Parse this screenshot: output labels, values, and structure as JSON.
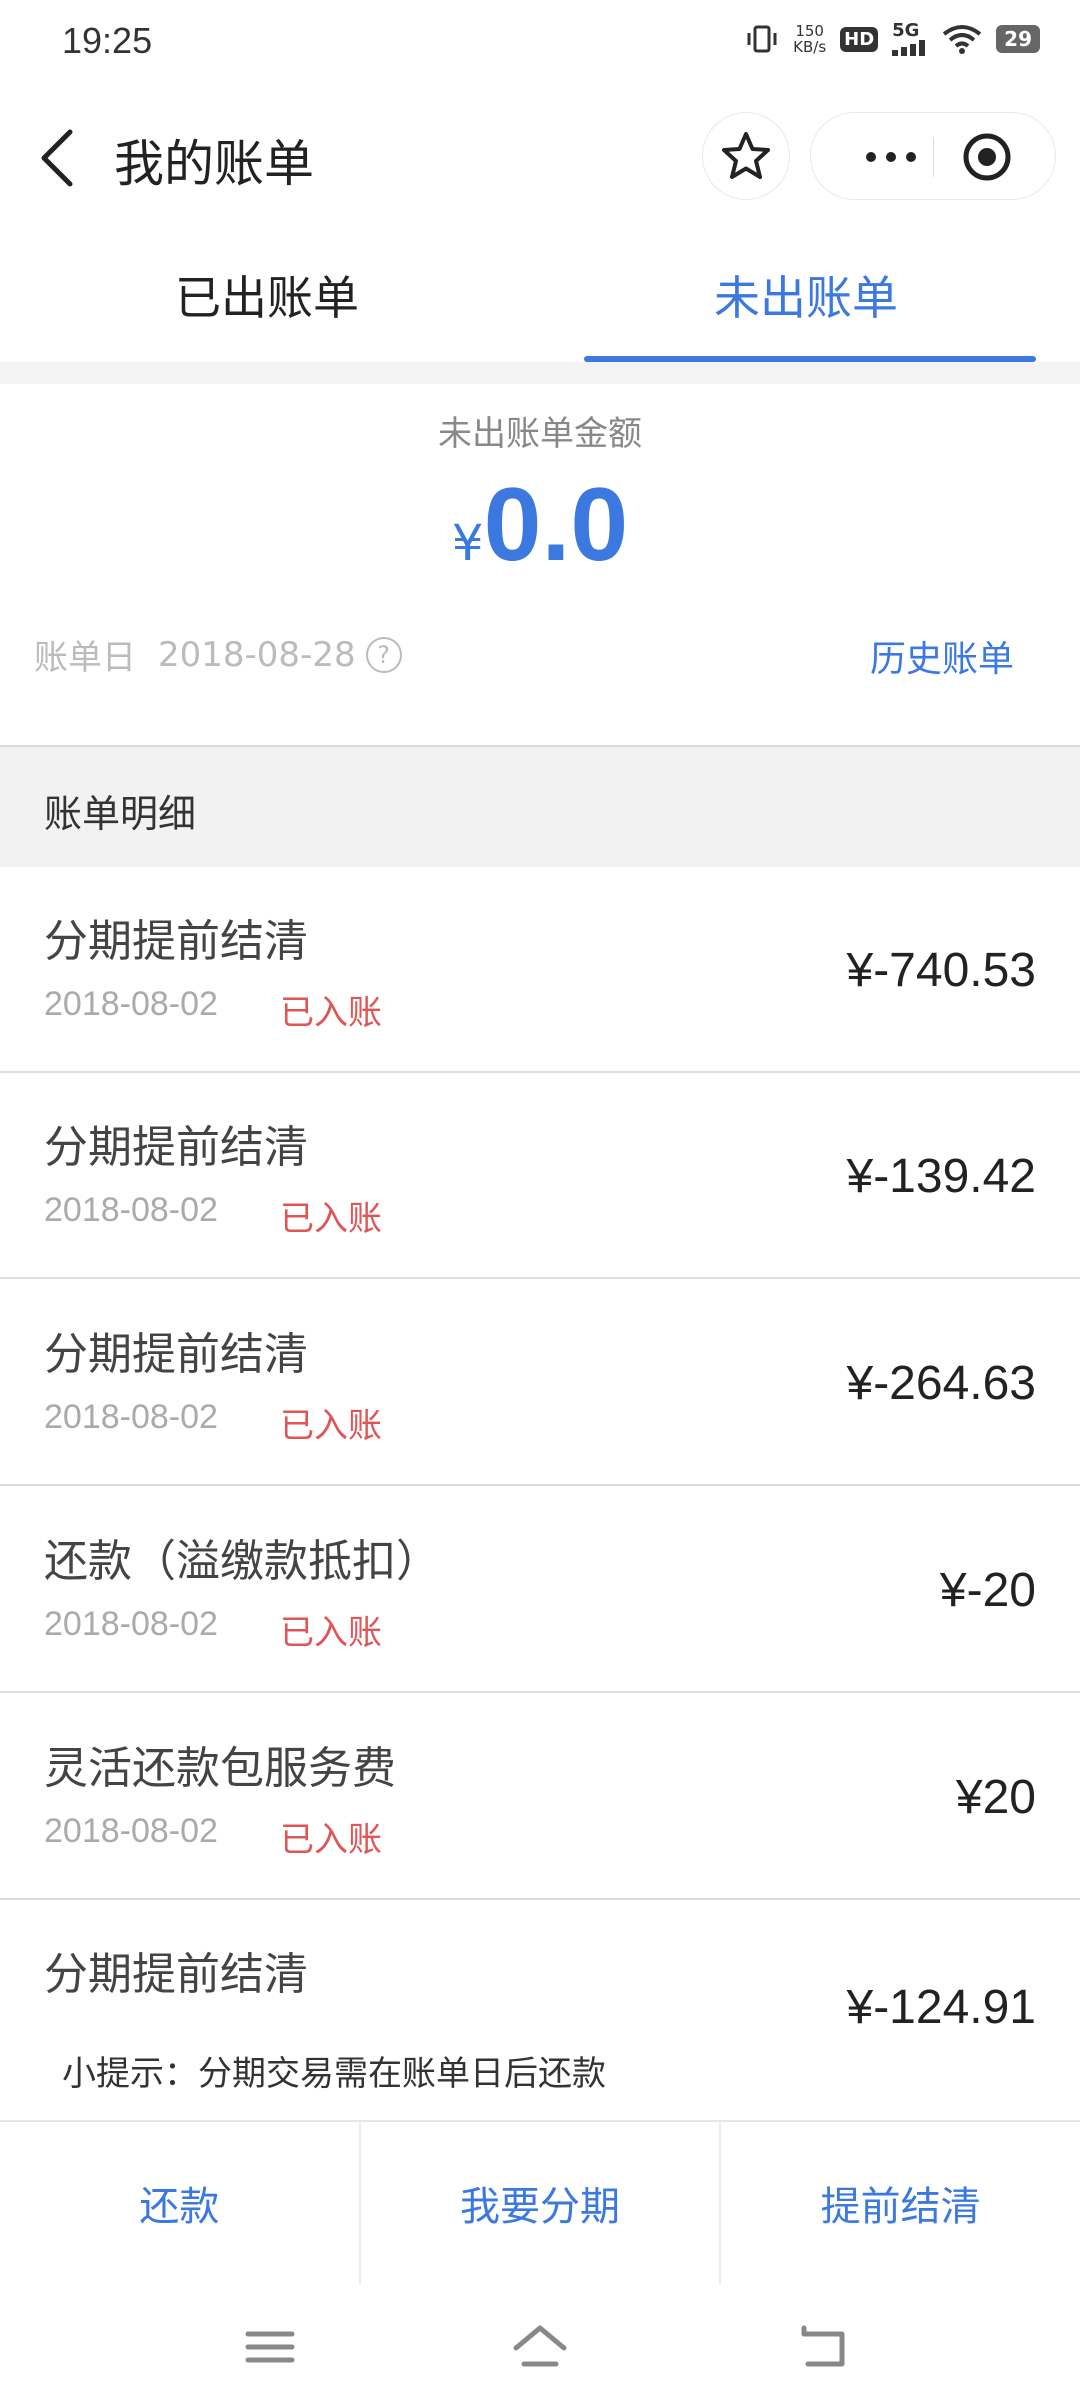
{
  "status_bar": {
    "time": "19:25",
    "speed_value": "150",
    "speed_unit": "KB/s",
    "hd": "HD",
    "network": "5G",
    "battery": "29"
  },
  "header": {
    "title": "我的账单"
  },
  "tabs": [
    {
      "label": "已出账单",
      "active": false
    },
    {
      "label": "未出账单",
      "active": true
    }
  ],
  "summary": {
    "label": "未出账单金额",
    "currency": "¥",
    "amount": "0.0",
    "bill_day_label": "账单日",
    "bill_day_value": "2018-08-28",
    "help_icon": "?",
    "history_link": "历史账单"
  },
  "details": {
    "header": "账单明细",
    "items": [
      {
        "name": "分期提前结清",
        "date": "2018-08-02",
        "status": "已入账",
        "amount": "¥-740.53"
      },
      {
        "name": "分期提前结清",
        "date": "2018-08-02",
        "status": "已入账",
        "amount": "¥-139.42"
      },
      {
        "name": "分期提前结清",
        "date": "2018-08-02",
        "status": "已入账",
        "amount": "¥-264.63"
      },
      {
        "name": "还款（溢缴款抵扣）",
        "date": "2018-08-02",
        "status": "已入账",
        "amount": "¥-20"
      },
      {
        "name": "灵活还款包服务费",
        "date": "2018-08-02",
        "status": "已入账",
        "amount": "¥20"
      },
      {
        "name": "分期提前结清",
        "date": "",
        "status": "",
        "amount": "¥-124.91"
      }
    ]
  },
  "tip": "小提示：分期交易需在账单日后还款",
  "actions": {
    "repay": "还款",
    "installment": "我要分期",
    "settle_early": "提前结清"
  },
  "colors": {
    "accent": "#3b78e0",
    "status_red": "#e05555"
  }
}
